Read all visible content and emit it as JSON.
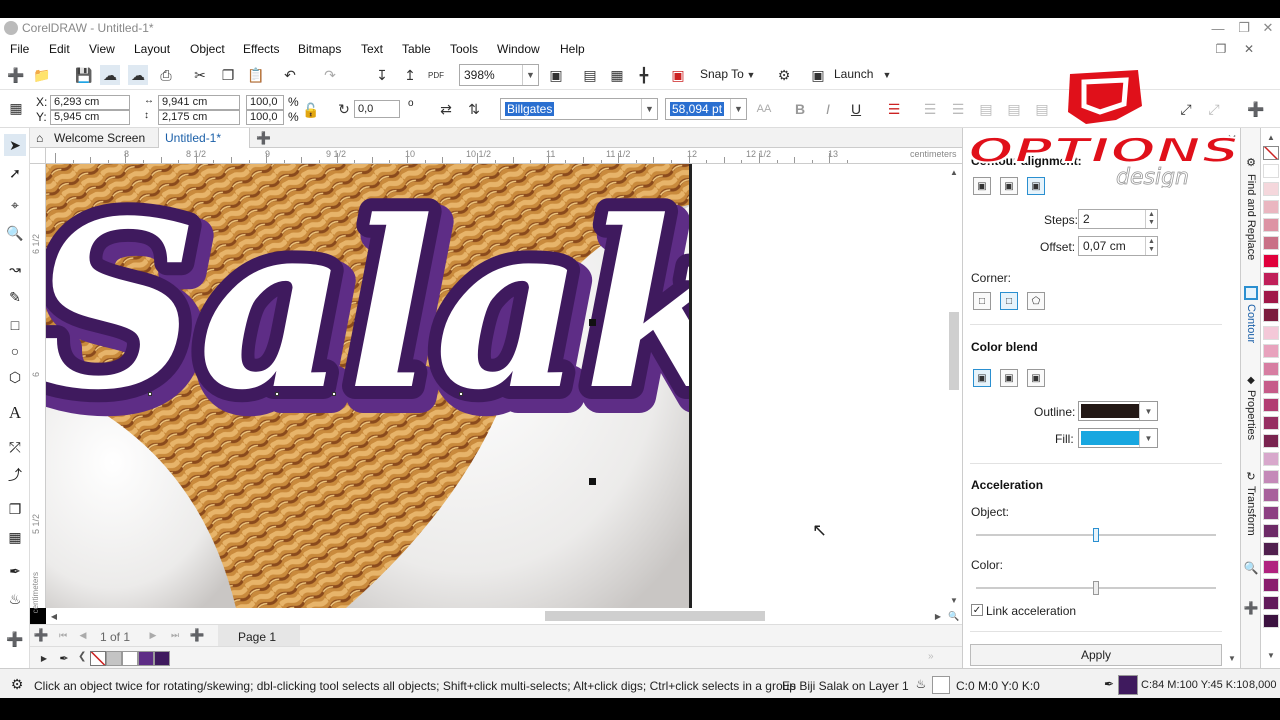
{
  "window": {
    "title": "CorelDRAW - Untitled-1*"
  },
  "menu": [
    {
      "label": "File",
      "u": "F"
    },
    {
      "label": "Edit",
      "u": "E"
    },
    {
      "label": "View",
      "u": "V"
    },
    {
      "label": "Layout",
      "u": "L"
    },
    {
      "label": "Object",
      "u": "O"
    },
    {
      "label": "Effects",
      "u": "C"
    },
    {
      "label": "Bitmaps",
      "u": "B"
    },
    {
      "label": "Text",
      "u": "X"
    },
    {
      "label": "Table",
      "u": "T"
    },
    {
      "label": "Tools",
      "u": "O"
    },
    {
      "label": "Window",
      "u": "W"
    },
    {
      "label": "Help",
      "u": "H"
    }
  ],
  "toolbar": {
    "zoom": "398%",
    "snap_label": "Snap To",
    "launch_label": "Launch"
  },
  "propbar": {
    "x": "6,293 cm",
    "y": "5,945 cm",
    "w": "9,941 cm",
    "h": "2,175 cm",
    "scale_x": "100,0",
    "scale_y": "100,0",
    "pct": "%",
    "rotation": "0,0",
    "rotation_unit": "o",
    "font": "Billgates",
    "font_size": "58,094 pt"
  },
  "tabs": {
    "welcome": "Welcome Screen",
    "doc": "Untitled-1*"
  },
  "ruler": {
    "unit": "centimeters",
    "labels": [
      "8",
      "8 1/2",
      "9",
      "9 1/2",
      "10",
      "10 1/2",
      "11",
      "11 1/2",
      "12",
      "12 1/2",
      "13"
    ],
    "vlabels": [
      "6 1/2",
      "6",
      "5 1/2"
    ]
  },
  "artwork": {
    "text": "Salak"
  },
  "pagenav": {
    "page_count": "1 of 1",
    "page_tab": "Page 1"
  },
  "docker": {
    "header": "Contour alignment:",
    "steps_label": "Steps:",
    "steps": "2",
    "offset_label": "Offset:",
    "offset": "0,07 cm",
    "corner_label": "Corner:",
    "color_blend_label": "Color blend",
    "outline_label": "Outline:",
    "fill_label": "Fill:",
    "outline_color": "#231815",
    "fill_color": "#18a7e0",
    "acceleration_label": "Acceleration",
    "object_label": "Object:",
    "object_accel": 0.5,
    "color_label": "Color:",
    "color_accel": 0.5,
    "link_accel_label": "Link acceleration",
    "link_accel_checked": true,
    "apply_label": "Apply"
  },
  "sidetabs": [
    "Find and Replace",
    "Contour",
    "Properties",
    "Transform"
  ],
  "palette_colors": [
    "#ffffff",
    "#f5d7dc",
    "#eab6c0",
    "#dd93a4",
    "#c97086",
    "#e0003c",
    "#c0205a",
    "#a01848",
    "#7b1c3d",
    "#f4c8d8",
    "#e8a2bd",
    "#d77ea2",
    "#c65c89",
    "#b23c72",
    "#962e62",
    "#7a2450",
    "#d8a8cc",
    "#c489b8",
    "#a8619c",
    "#8c3f82",
    "#6d2a67",
    "#51204f",
    "#b0237f",
    "#8a1e6e",
    "#611a5a",
    "#3c1240"
  ],
  "statusbar": {
    "hint": "Click an object twice for rotating/skewing; dbl-clicking tool selects all objects; Shift+click multi-selects; Alt+click digs; Ctrl+click selects in a group",
    "selection": "Es Biji Salak on Layer 1",
    "fill_cmyk": "C:0 M:0 Y:0 K:0",
    "outline_cmyk": "C:84 M:100 Y:45 K:10",
    "outline_width": "8,000"
  },
  "watermark": {
    "text1": "OPTIONS",
    "text2": "design"
  },
  "colors": {
    "accent": "#2a8fd0",
    "purple_dark": "#3f1a5e",
    "purple_light": "#5e2d86"
  }
}
